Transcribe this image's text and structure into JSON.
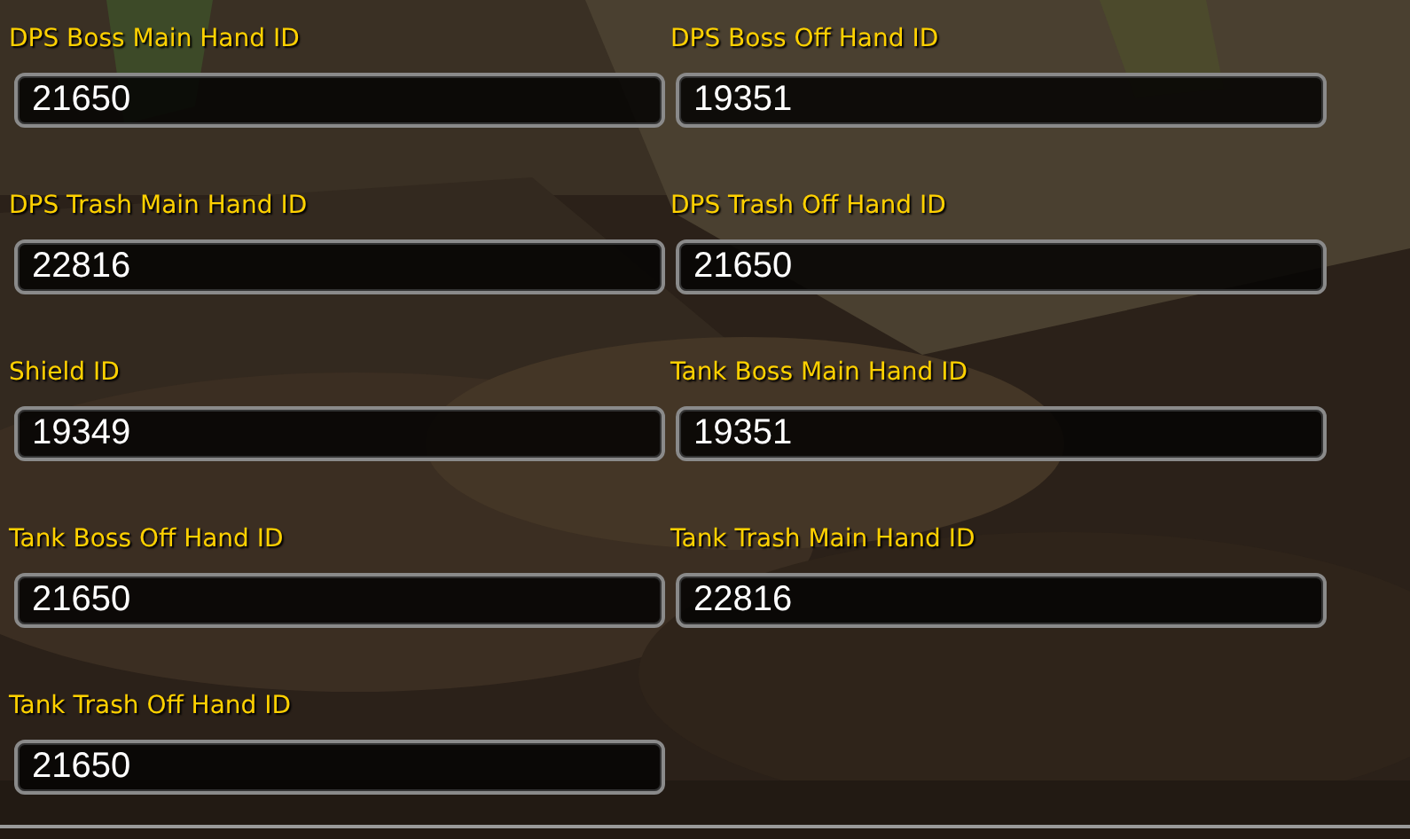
{
  "fields": [
    {
      "label": "DPS Boss Main Hand ID",
      "value": "21650"
    },
    {
      "label": "DPS Boss Off Hand ID",
      "value": "19351"
    },
    {
      "label": "DPS Trash Main Hand ID",
      "value": "22816"
    },
    {
      "label": "DPS Trash Off Hand ID",
      "value": "21650"
    },
    {
      "label": "Shield ID",
      "value": "19349"
    },
    {
      "label": "Tank Boss Main Hand ID",
      "value": "19351"
    },
    {
      "label": "Tank Boss Off Hand ID",
      "value": "21650"
    },
    {
      "label": "Tank Trash Main Hand ID",
      "value": "22816"
    },
    {
      "label": "Tank Trash Off Hand ID",
      "value": "21650"
    }
  ]
}
